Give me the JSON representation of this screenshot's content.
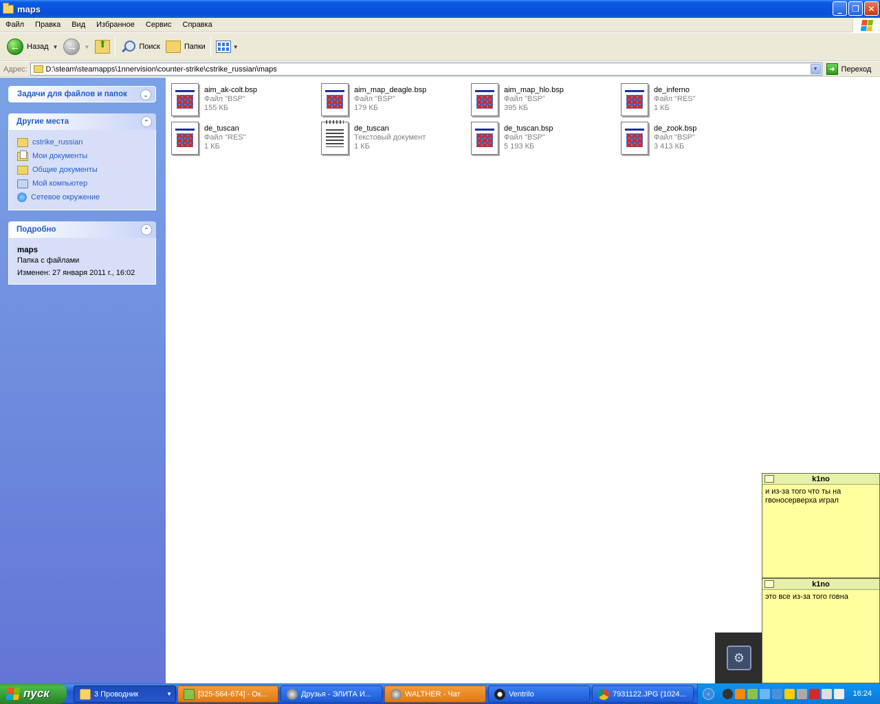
{
  "window": {
    "title": "maps",
    "buttons": [
      "_",
      "❐",
      "✕"
    ]
  },
  "menu": [
    "Файл",
    "Правка",
    "Вид",
    "Избранное",
    "Сервис",
    "Справка"
  ],
  "toolbar": {
    "back_label": "Назад",
    "search_label": "Поиск",
    "folders_label": "Папки"
  },
  "address": {
    "label": "Адрес:",
    "path": "D:\\steam\\steamapps\\1nnervision\\counter-strike\\cstrike_russian\\maps",
    "go_label": "Переход"
  },
  "left_pane": {
    "tasks_title": "Задачи для файлов и папок",
    "places_title": "Другие места",
    "places": [
      {
        "label": "cstrike_russian",
        "icon": "folder-icon"
      },
      {
        "label": "Мои документы",
        "icon": "my-documents-icon"
      },
      {
        "label": "Общие документы",
        "icon": "folder-icon"
      },
      {
        "label": "Мой компьютер",
        "icon": "my-computer-icon"
      },
      {
        "label": "Сетевое окружение",
        "icon": "network-icon"
      }
    ],
    "details_title": "Подробно",
    "details": {
      "name": "maps",
      "type": "Папка с файлами",
      "modified": "Изменен: 27 января 2011 г., 16:02"
    }
  },
  "files": [
    {
      "name": "aim_ak-colt.bsp",
      "type": "Файл \"BSP\"",
      "size": "155 КБ",
      "icon": "bsp-file-icon"
    },
    {
      "name": "aim_map_deagle.bsp",
      "type": "Файл \"BSP\"",
      "size": "179 КБ",
      "icon": "bsp-file-icon"
    },
    {
      "name": "aim_map_hlo.bsp",
      "type": "Файл \"BSP\"",
      "size": "395 КБ",
      "icon": "bsp-file-icon"
    },
    {
      "name": "de_inferno",
      "type": "Файл \"RES\"",
      "size": "1 КБ",
      "icon": "res-file-icon"
    },
    {
      "name": "de_tuscan",
      "type": "Файл \"RES\"",
      "size": "1 КБ",
      "icon": "res-file-icon"
    },
    {
      "name": "de_tuscan",
      "type": "Текстовый документ",
      "size": "1 КБ",
      "icon": "text-file-icon"
    },
    {
      "name": "de_tuscan.bsp",
      "type": "Файл \"BSP\"",
      "size": "5 193 КБ",
      "icon": "bsp-file-icon"
    },
    {
      "name": "de_zook.bsp",
      "type": "Файл \"BSP\"",
      "size": "3 413 КБ",
      "icon": "bsp-file-icon"
    }
  ],
  "notifications": [
    {
      "title": "k1no",
      "message": "и из-за того что ты на гвоносерверха играл"
    },
    {
      "title": "k1no",
      "message": "это все из-за того говна"
    }
  ],
  "taskbar": {
    "start_label": "пуск",
    "tasks": [
      {
        "label": "3 Проводник",
        "icon": "folder-icon"
      },
      {
        "label": "[325-564-674] - Ок...",
        "icon": "icq-icon"
      },
      {
        "label": "Друзья - ЭЛИТА И...",
        "icon": "steam-icon"
      },
      {
        "label": "WALTHER - Чат",
        "icon": "steam-icon"
      },
      {
        "label": "Ventrilo",
        "icon": "ventrilo-icon"
      },
      {
        "label": "7931122.JPG (1024...",
        "icon": "chrome-icon"
      }
    ],
    "clock": "16:24"
  }
}
